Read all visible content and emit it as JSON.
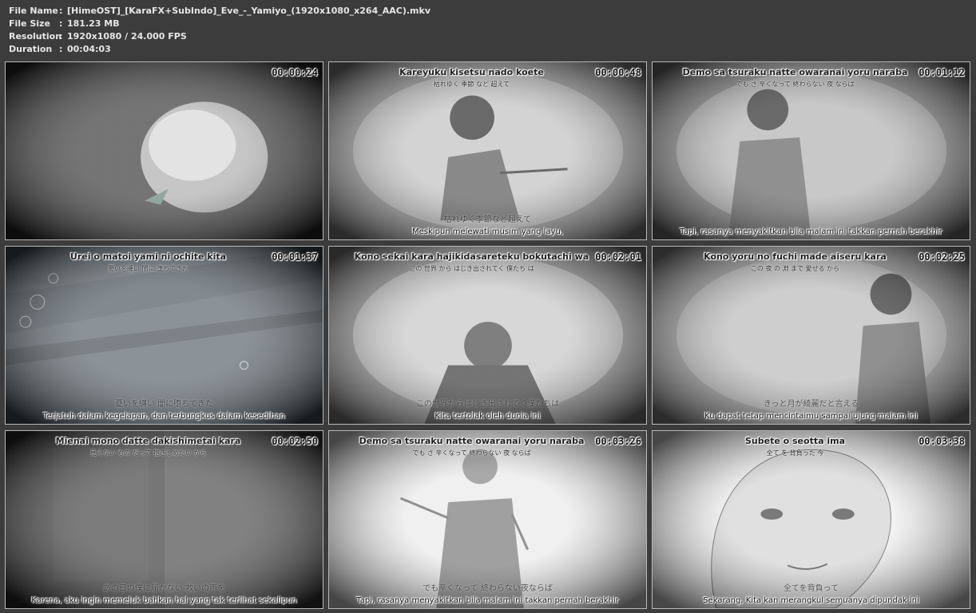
{
  "info": {
    "rows": [
      {
        "key": "File Name",
        "sep": ":",
        "value": "[HimeOST]_[KaraFX+SubIndo]_Eve_-_Yamiyo_(1920x1080_x264_AAC).mkv"
      },
      {
        "key": "File Size",
        "sep": ":",
        "value": "181.23 MB"
      },
      {
        "key": "Resolution",
        "sep": ":",
        "value": "1920x1080 / 24.000 FPS"
      },
      {
        "key": "Duration",
        "sep": ":",
        "value": "00:04:03"
      }
    ]
  },
  "thumbnails": [
    {
      "time": "00:00:24",
      "romaji": "",
      "kanji": "",
      "jp_sub": "",
      "sub": "",
      "scene": "flower",
      "bg": "#2a2a2a"
    },
    {
      "time": "00:00:48",
      "romaji": "Kareyuku kisetsu nado koete",
      "kanji": "枯れゆく 季節 など 超えて",
      "jp_sub": "枯れゆく季節など超えて",
      "sub": "Meskipun melewati musim yang layu,",
      "scene": "figure-hands",
      "bg": "#8f8f8f"
    },
    {
      "time": "00:01:12",
      "romaji": "Demo sa tsuraku natte owaranai yoru naraba",
      "kanji": "でも さ 辛くなって 終わらない 夜 ならば",
      "jp_sub": "",
      "sub": "Tapi, rasanya menyakitkan bila malam ini takkan pernah berakhir",
      "scene": "figure-robe",
      "bg": "#7c7c7c"
    },
    {
      "time": "00:01:37",
      "romaji": "Urei o matoi yami ni ochite kita",
      "kanji": "憂いを纏い 闇に 堕ちてきた",
      "jp_sub": "憂いを纏い 闇に堕ちてきた",
      "sub": "Terjatuh dalam kegelapan, dan terbungkus dalam kesedihan",
      "scene": "underwater",
      "bg": "#4c5760"
    },
    {
      "time": "00:02:01",
      "romaji": "Kono sekai kara hajikidasareteku bokutachi wa",
      "kanji": "この 世界 から はじき出されてく 僕たち は",
      "jp_sub": "この世界からはじき出されてく僕たちは",
      "sub": "Kita tertolak oleh dunia ini",
      "scene": "figure-head",
      "bg": "#8a8a8a"
    },
    {
      "time": "00:02:25",
      "romaji": "Kono yoru no fuchi made aiseru kara",
      "kanji": "この 夜 の 淵 まで 愛せる から",
      "jp_sub": "きっと月が綺麗だと言える",
      "sub": "Ku dapat tetap mencintaimu sampai ujung malam ini",
      "scene": "figure-robe2",
      "bg": "#929292"
    },
    {
      "time": "00:02:50",
      "romaji": "Mienai mono datte dakishimetai kara",
      "kanji": "見えない もの だって 抱きしめたい から",
      "jp_sub": "あの日の僕に届かない 救いの声を",
      "sub": "Karena, aku ingin memeluk bahkan hal yang tak terlihat sekalipun",
      "scene": "texture",
      "bg": "#2c2c2c"
    },
    {
      "time": "00:03:26",
      "romaji": "Demo sa tsuraku natte owaranai yoru naraba",
      "kanji": "でも さ 辛くなって 終わらない 夜 ならば",
      "jp_sub": "でも辛くなって 終わらない夜ならば",
      "sub": "Tapi, rasanya menyakitkan bila malam ini takkan pernah berakhir",
      "scene": "figure-light",
      "bg": "#e8e8e8"
    },
    {
      "time": "00:03:38",
      "romaji": "Subete o seotta ima",
      "kanji": "全て を 背負った 今",
      "jp_sub": "全てを背負って",
      "sub": "Sekarang, Kita kan merangkul semuanya dipundak ini",
      "scene": "face",
      "bg": "#ededed"
    }
  ]
}
